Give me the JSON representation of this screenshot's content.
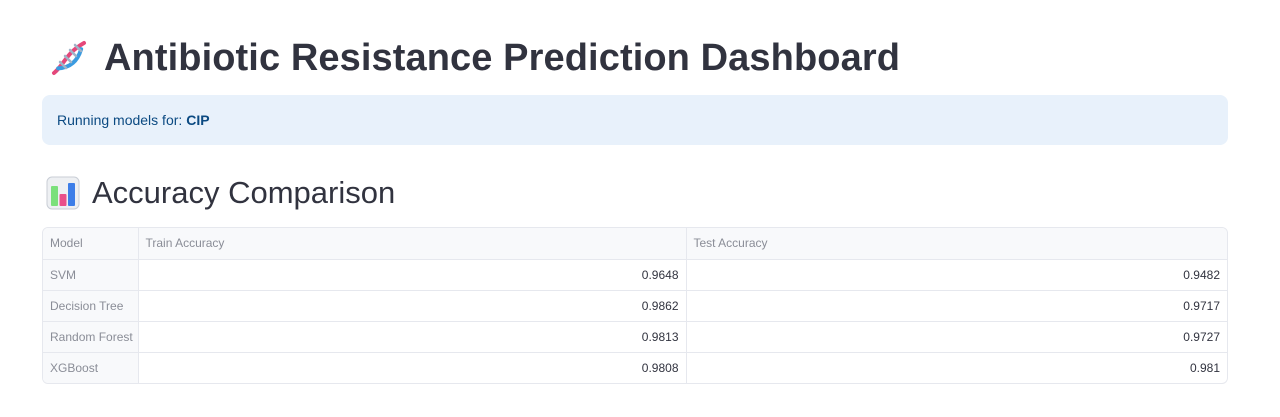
{
  "header": {
    "title": "Antibiotic Resistance Prediction Dashboard",
    "icon": "dna-icon"
  },
  "info": {
    "label": "Running models for:",
    "antibiotic": "CIP"
  },
  "section": {
    "title": "Accuracy Comparison",
    "icon": "bar-chart-icon"
  },
  "table": {
    "columns": [
      "Model",
      "Train Accuracy",
      "Test Accuracy"
    ],
    "rows": [
      {
        "model": "SVM",
        "train": "0.9648",
        "test": "0.9482"
      },
      {
        "model": "Decision Tree",
        "train": "0.9862",
        "test": "0.9717"
      },
      {
        "model": "Random Forest",
        "train": "0.9813",
        "test": "0.9727"
      },
      {
        "model": "XGBoost",
        "train": "0.9808",
        "test": "0.981"
      }
    ]
  },
  "colors": {
    "info_background": "#e8f1fb",
    "info_text": "#0b4a82",
    "text": "#31333f",
    "muted": "#8a8d97"
  }
}
